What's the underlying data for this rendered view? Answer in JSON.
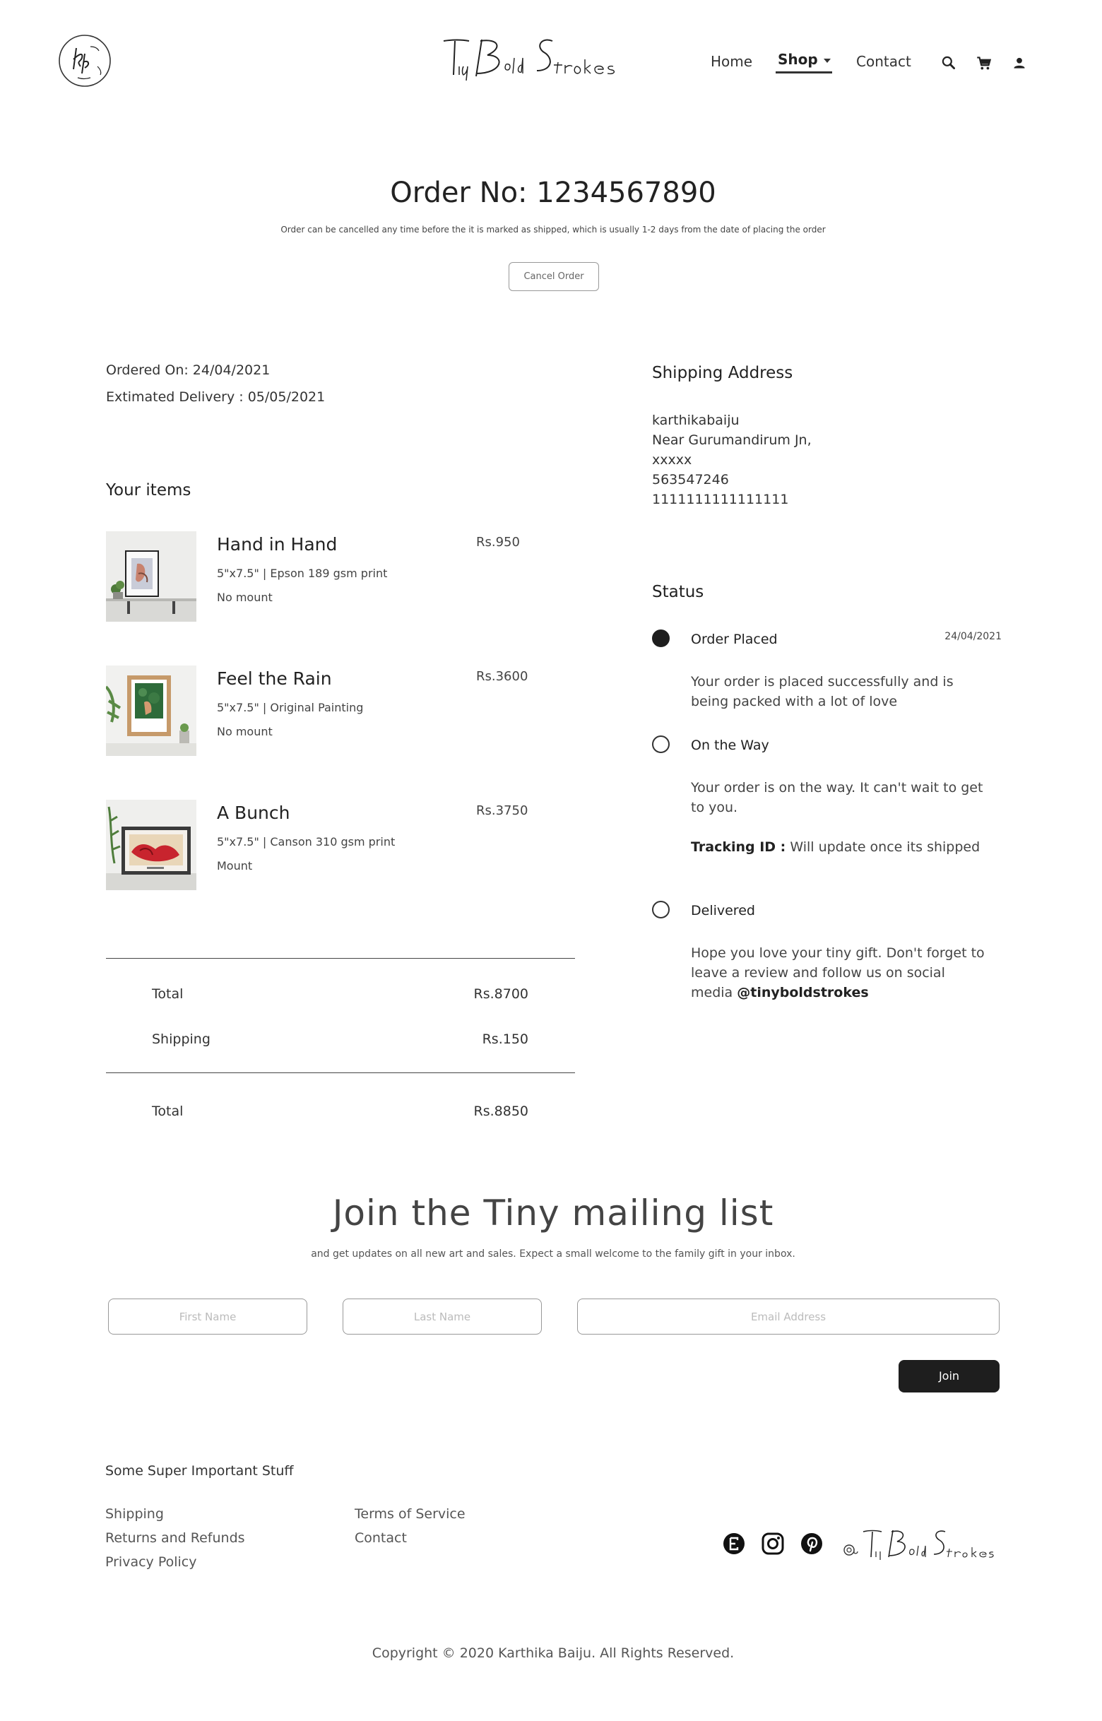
{
  "header": {
    "brand": "TinyBoldStrokes",
    "nav": [
      {
        "label": "Home"
      },
      {
        "label": "Shop"
      },
      {
        "label": "Contact"
      }
    ],
    "icons": [
      "search-icon",
      "cart-icon",
      "user-icon"
    ]
  },
  "order": {
    "title": "Order No: 1234567890",
    "note": "Order can be  cancelled any time before the it is marked as shipped, which is usually 1-2 days from the date of placing the order",
    "cancel_label": "Cancel Order",
    "ordered_on": "Ordered On: 24/04/2021",
    "delivery": "Extimated Delivery : 05/05/2021"
  },
  "items_heading": "Your items",
  "items": [
    {
      "name": "Hand in Hand",
      "spec": "5\"x7.5\" | Epson 189 gsm print",
      "mount": "No mount",
      "price": "Rs.950"
    },
    {
      "name": "Feel the Rain",
      "spec": "5\"x7.5\" | Original Painting",
      "mount": "No mount",
      "price": "Rs.3600"
    },
    {
      "name": "A Bunch",
      "spec": "5\"x7.5\" | Canson 310 gsm print",
      "mount": "Mount",
      "price": "Rs.3750"
    }
  ],
  "totals": {
    "subtotal_label": "Total",
    "subtotal": "Rs.8700",
    "shipping_label": "Shipping",
    "shipping": "Rs.150",
    "total_label": "Total",
    "total": "Rs.8850"
  },
  "shipping_address": {
    "heading": "Shipping Address",
    "lines": [
      "karthikabaiju",
      "Near Gurumandirum Jn,",
      "xxxxx",
      "563547246",
      "1111111111111111"
    ]
  },
  "status": {
    "heading": "Status",
    "steps": [
      {
        "label": "Order Placed",
        "date": "24/04/2021",
        "desc": "Your order is placed successfully and is being packed with a lot of love",
        "done": true
      },
      {
        "label": "On the Way",
        "desc": "Your order is on the way. It can't wait to get to you.",
        "tracking_label": "Tracking ID :",
        "tracking_value": "Will update once its shipped",
        "done": false
      },
      {
        "label": "Delivered",
        "desc": "Hope you love your tiny gift. Don't forget to leave a review and follow us on social media",
        "handle": "@tinyboldstrokes",
        "done": false
      }
    ]
  },
  "mailing": {
    "title": "Join the Tiny mailing list",
    "subtitle": "and get updates on all new art and sales. Expect a small welcome to the family gift in your inbox.",
    "first_name_placeholder": "First Name",
    "last_name_placeholder": "Last Name",
    "email_placeholder": "Email Address",
    "join_label": "Join"
  },
  "footer": {
    "heading": "Some Super Important Stuff",
    "links_col1": [
      "Shipping",
      "Returns and Refunds",
      "Privacy Policy"
    ],
    "links_col2": [
      "Terms of Service",
      "Contact"
    ],
    "social": [
      "etsy-icon",
      "instagram-icon",
      "pinterest-icon"
    ],
    "copyright": "Copyright © 2020 Karthika Baiju. All Rights Reserved."
  },
  "colors": {
    "accent": "#1e1e1e",
    "text": "#333333",
    "muted": "#555555"
  }
}
